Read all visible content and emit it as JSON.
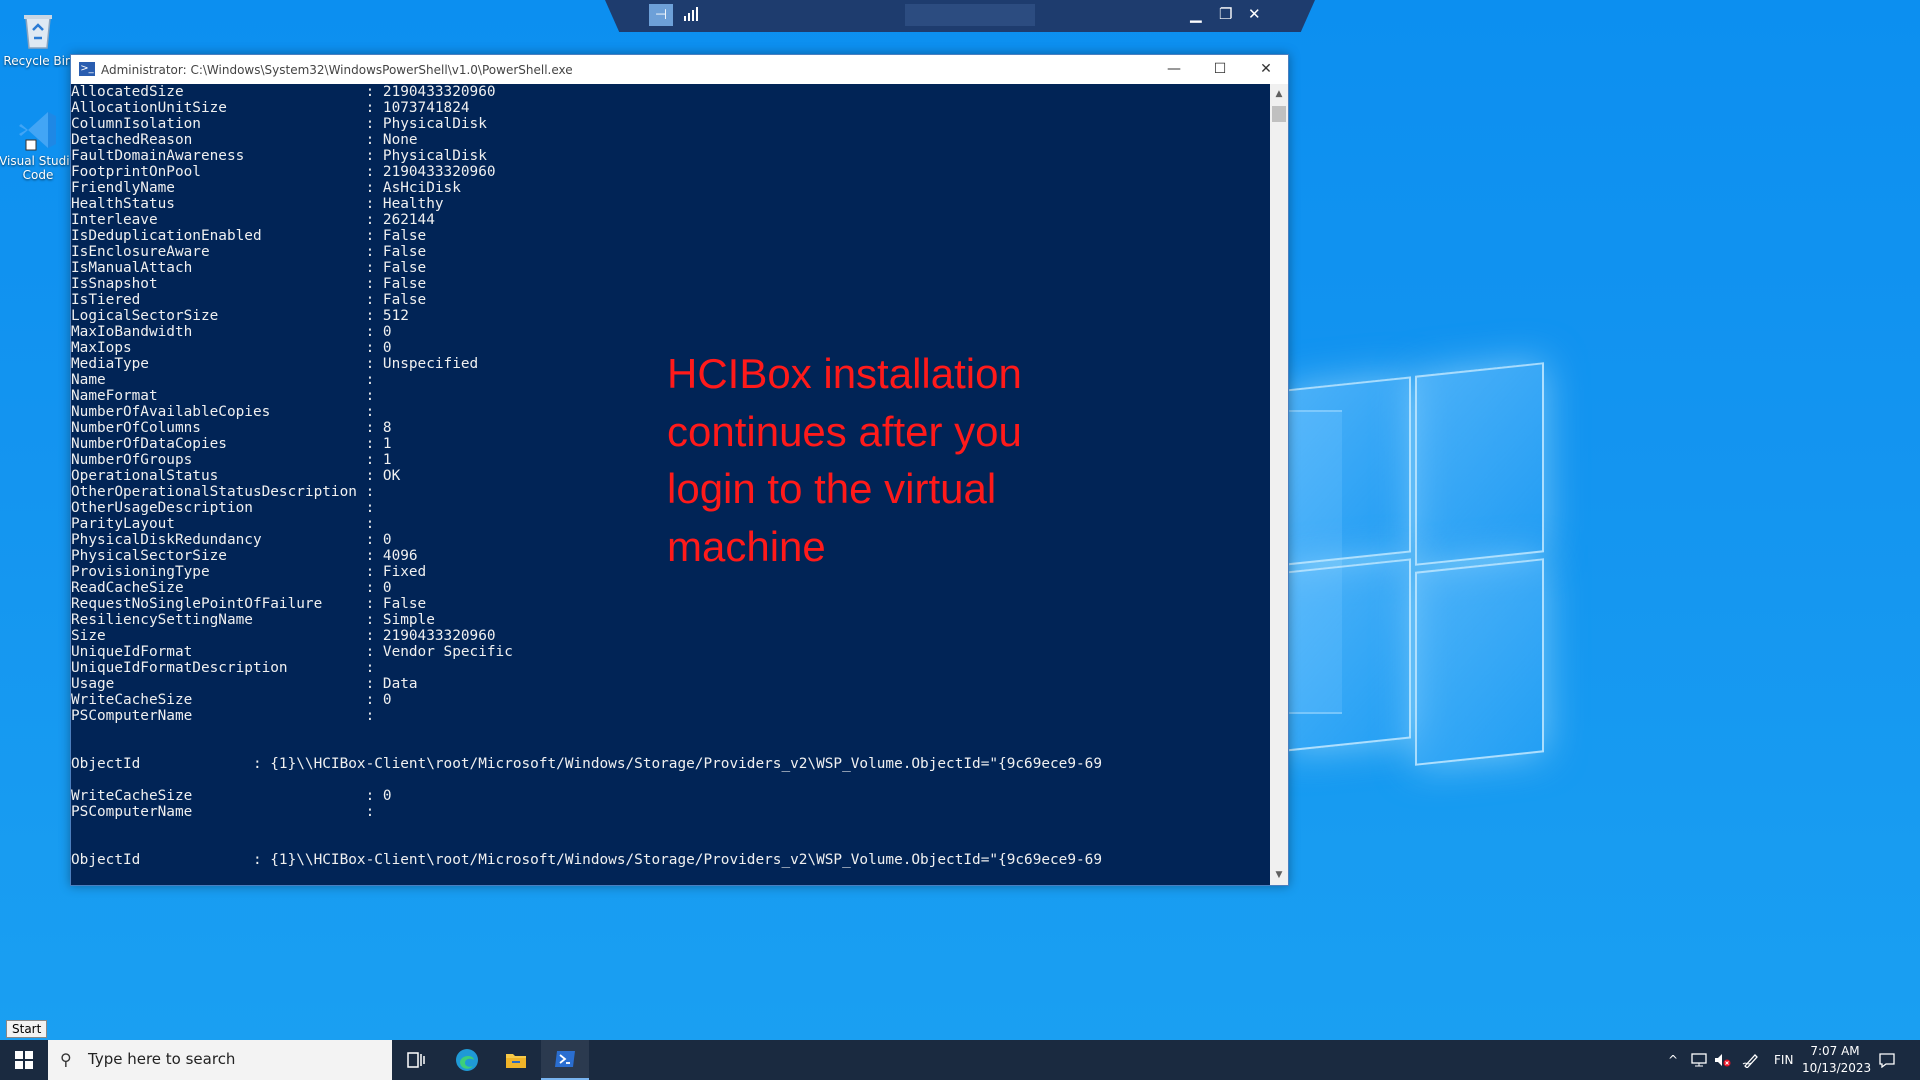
{
  "desktop": {
    "icons": [
      {
        "label": "Recycle Bin"
      },
      {
        "label": "Visual Studio Code"
      }
    ]
  },
  "remote_bar": {
    "pin_icon": "pin-icon",
    "signal_icon": "signal-bars-icon"
  },
  "window": {
    "title": "Administrator: C:\\Windows\\System32\\WindowsPowerShell\\v1.0\\PowerShell.exe",
    "minimize": "—",
    "maximize": "☐",
    "close": "✕"
  },
  "console": {
    "text": "AllocatedSize                     : 2190433320960\nAllocationUnitSize                : 1073741824\nColumnIsolation                   : PhysicalDisk\nDetachedReason                    : None\nFaultDomainAwareness              : PhysicalDisk\nFootprintOnPool                   : 2190433320960\nFriendlyName                      : AsHciDisk\nHealthStatus                      : Healthy\nInterleave                        : 262144\nIsDeduplicationEnabled            : False\nIsEnclosureAware                  : False\nIsManualAttach                    : False\nIsSnapshot                        : False\nIsTiered                          : False\nLogicalSectorSize                 : 512\nMaxIoBandwidth                    : 0\nMaxIops                           : 0\nMediaType                         : Unspecified\nName                              :\nNameFormat                        :\nNumberOfAvailableCopies           :\nNumberOfColumns                   : 8\nNumberOfDataCopies                : 1\nNumberOfGroups                    : 1\nOperationalStatus                 : OK\nOtherOperationalStatusDescription :\nOtherUsageDescription             :\nParityLayout                      :\nPhysicalDiskRedundancy            : 0\nPhysicalSectorSize                : 4096\nProvisioningType                  : Fixed\nReadCacheSize                     : 0\nRequestNoSinglePointOfFailure     : False\nResiliencySettingName             : Simple\nSize                              : 2190433320960\nUniqueIdFormat                    : Vendor Specific\nUniqueIdFormatDescription         :\nUsage                             : Data\nWriteCacheSize                    : 0\nPSComputerName                    :\n\n\nObjectId             : {1}\\\\HCIBox-Client\\root/Microsoft/Windows/Storage/Providers_v2\\WSP_Volume.ObjectId=\"{9c69ece9-69\n\nWriteCacheSize                    : 0\nPSComputerName                    :\n\n\nObjectId             : {1}\\\\HCIBox-Client\\root/Microsoft/Windows/Storage/Providers_v2\\WSP_Volume.ObjectId=\"{9c69ece9-69"
  },
  "overlay": {
    "text": "HCIBox installation continues after you login to the virtual machine",
    "color": "#ff1a1a"
  },
  "start_tooltip": "Start",
  "taskbar": {
    "search_placeholder": "Type here to search",
    "language": "FIN",
    "time": "7:07 AM",
    "date": "10/13/2023"
  }
}
